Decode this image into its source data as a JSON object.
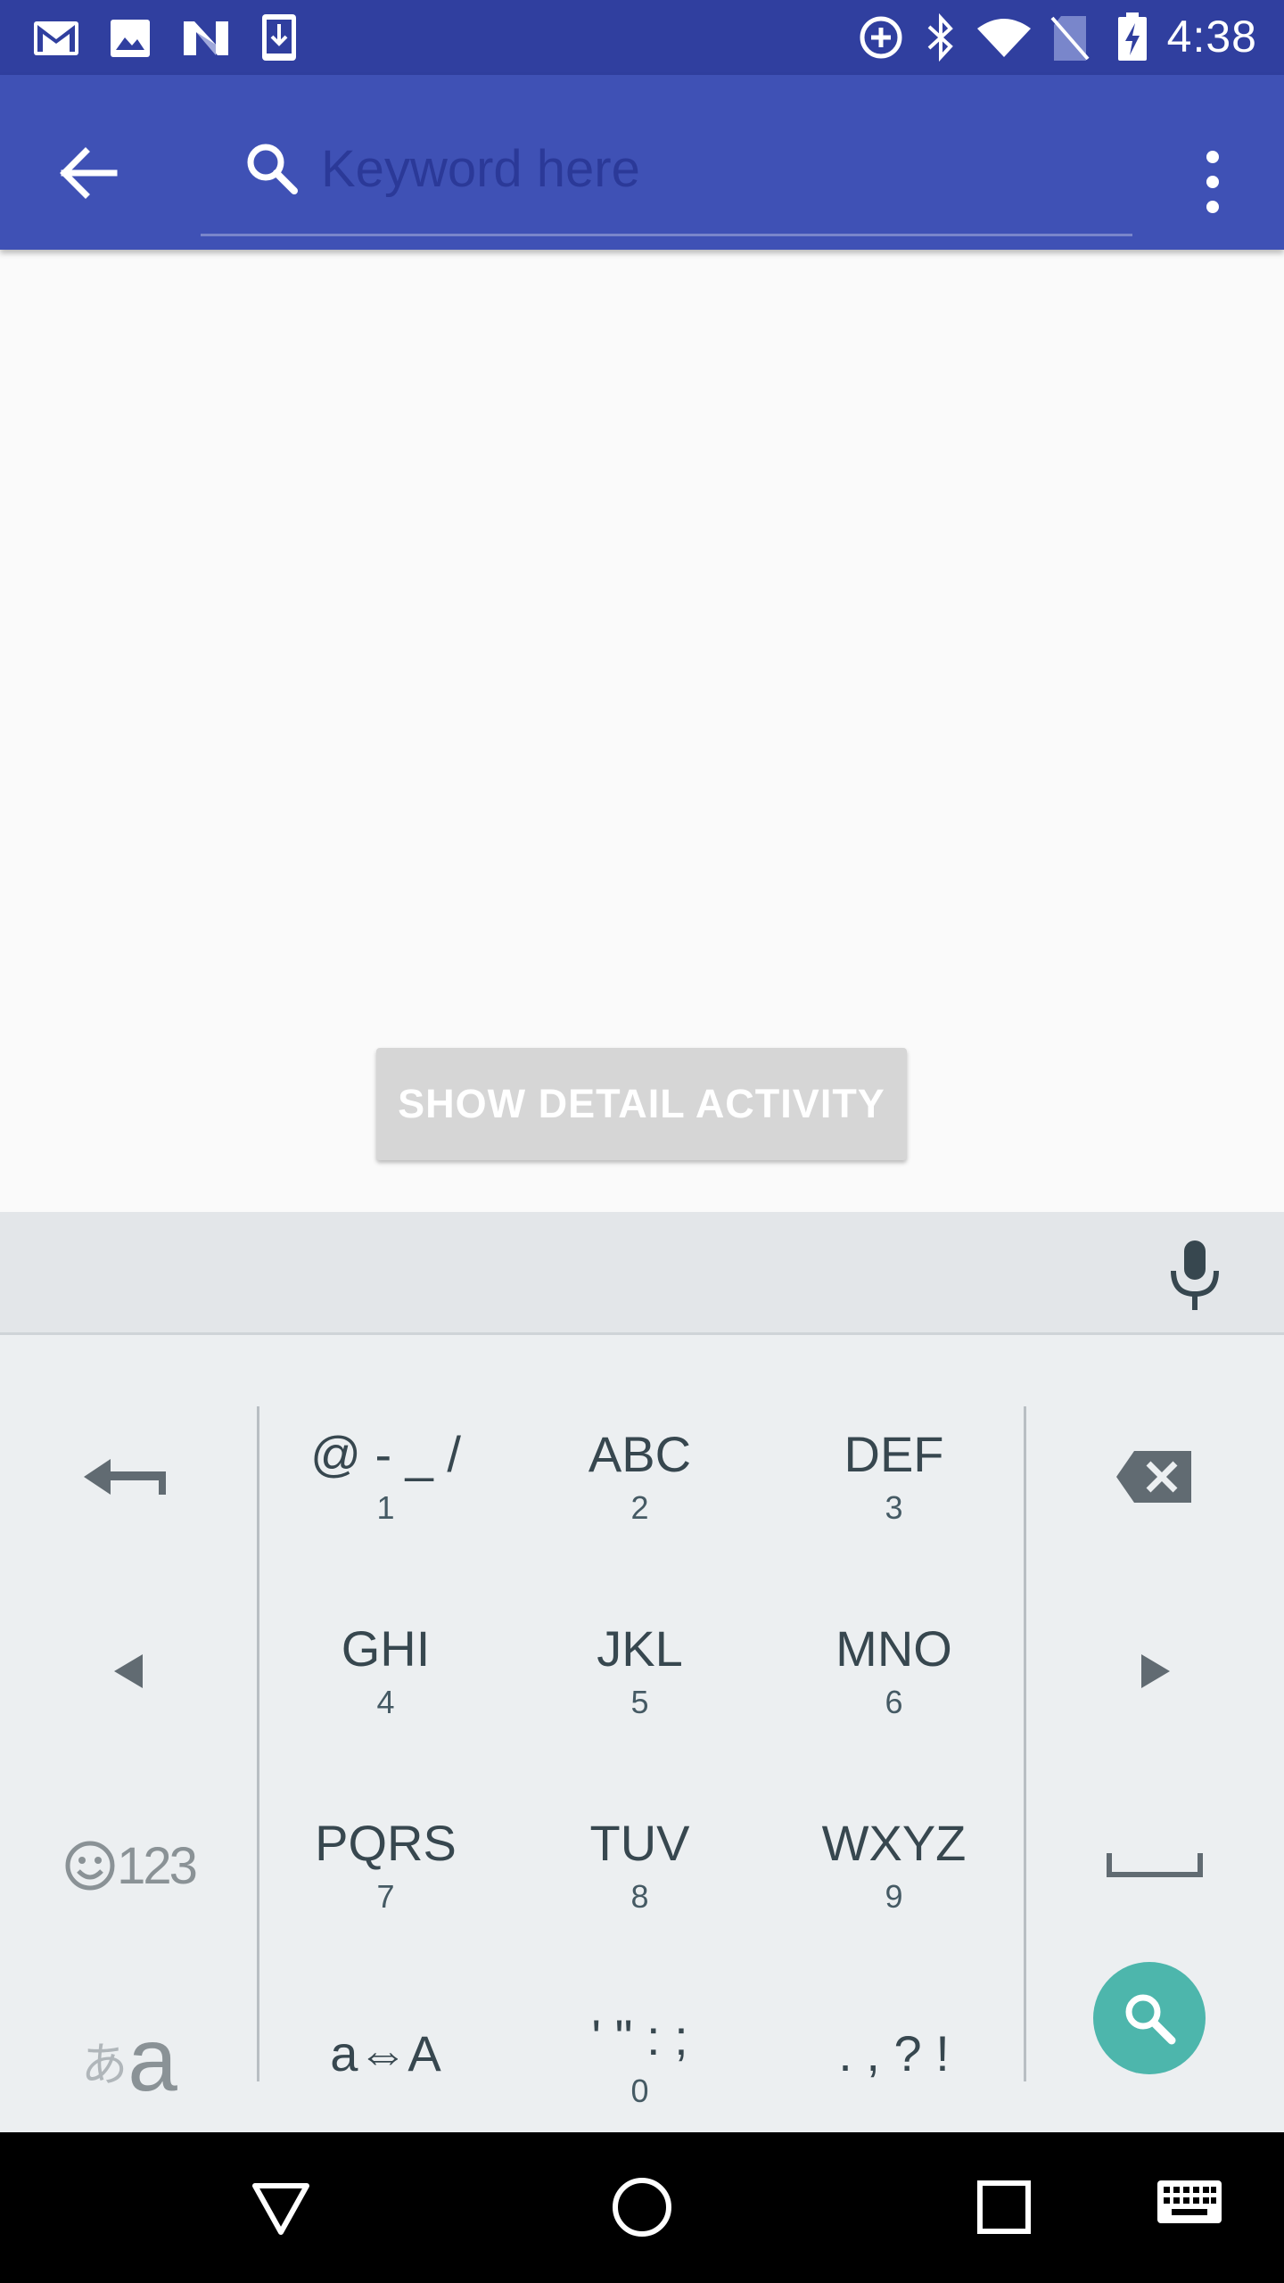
{
  "status_bar": {
    "time": "4:38",
    "left_icons": [
      "gmail-icon",
      "image-icon",
      "n-logo-icon",
      "download-icon"
    ],
    "right_icons": [
      "data-saver-icon",
      "bluetooth-icon",
      "wifi-icon",
      "no-sim-icon",
      "battery-charging-icon"
    ]
  },
  "toolbar": {
    "search_placeholder": "Keyword here"
  },
  "main": {
    "show_detail_label": "SHOW DETAIL ACTIVITY"
  },
  "keyboard": {
    "rows": [
      [
        {
          "main": "@ - _ /",
          "sub": "1"
        },
        {
          "main": "ABC",
          "sub": "2"
        },
        {
          "main": "DEF",
          "sub": "3"
        }
      ],
      [
        {
          "main": "GHI",
          "sub": "4"
        },
        {
          "main": "JKL",
          "sub": "5"
        },
        {
          "main": "MNO",
          "sub": "6"
        }
      ],
      [
        {
          "main": "PQRS",
          "sub": "7"
        },
        {
          "main": "TUV",
          "sub": "8"
        },
        {
          "main": "WXYZ",
          "sub": "9"
        }
      ],
      [
        {
          "main": "a⇔A",
          "sub": ""
        },
        {
          "main": "' \" : ;",
          "sub": "0"
        },
        {
          "main": ". , ? !",
          "sub": ""
        }
      ]
    ],
    "emoji_key_label": "123",
    "kana_key_small": "あ",
    "kana_key_large": "a"
  },
  "colors": {
    "status_bar": "#303f9f",
    "toolbar": "#3f51b5",
    "keyboard_bg": "#eceff1",
    "search_action": "#4db6ac"
  }
}
